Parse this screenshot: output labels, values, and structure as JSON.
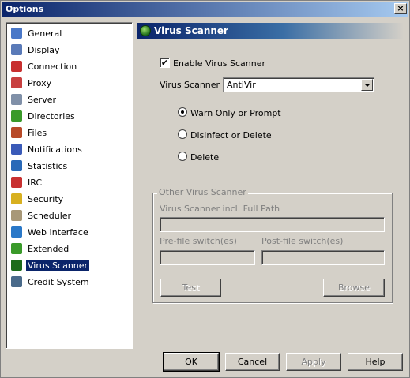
{
  "window": {
    "title": "Options",
    "close_glyph": "×"
  },
  "nav": {
    "items": [
      {
        "label": "General",
        "icon": "wrench-icon",
        "color": "#4a78c8"
      },
      {
        "label": "Display",
        "icon": "monitor-icon",
        "color": "#5a7ab8"
      },
      {
        "label": "Connection",
        "icon": "plug-icon",
        "color": "#c83030"
      },
      {
        "label": "Proxy",
        "icon": "server-arrows-icon",
        "color": "#c84040"
      },
      {
        "label": "Server",
        "icon": "tower-icon",
        "color": "#8090a8"
      },
      {
        "label": "Directories",
        "icon": "folder-icon",
        "color": "#3a9a2a"
      },
      {
        "label": "Files",
        "icon": "files-icon",
        "color": "#b84a28"
      },
      {
        "label": "Notifications",
        "icon": "bell-icon",
        "color": "#3a5ab8"
      },
      {
        "label": "Statistics",
        "icon": "chart-icon",
        "color": "#2a6ab8"
      },
      {
        "label": "IRC",
        "icon": "chat-icon",
        "color": "#c83030"
      },
      {
        "label": "Security",
        "icon": "lock-icon",
        "color": "#d8b020"
      },
      {
        "label": "Scheduler",
        "icon": "calendar-icon",
        "color": "#a89878"
      },
      {
        "label": "Web Interface",
        "icon": "globe-icon",
        "color": "#2a78c8"
      },
      {
        "label": "Extended",
        "icon": "leaf-icon",
        "color": "#3a9a2a"
      },
      {
        "label": "Virus Scanner",
        "icon": "virus-scanner-icon",
        "color": "#1d6b1a",
        "selected": true
      },
      {
        "label": "Credit System",
        "icon": "credit-icon",
        "color": "#4a6a8a"
      }
    ]
  },
  "panel": {
    "title": "Virus Scanner",
    "enable_checkbox": {
      "label": "Enable Virus Scanner",
      "checked": true,
      "mark": "✔"
    },
    "scanner_select": {
      "label": "Virus Scanner",
      "value": "AntiVir"
    },
    "radios": [
      {
        "label": "Warn Only or Prompt",
        "selected": true
      },
      {
        "label": "Disinfect or Delete",
        "selected": false
      },
      {
        "label": "Delete",
        "selected": false
      }
    ],
    "other_scanner": {
      "group_title": "Other Virus Scanner",
      "path_label": "Virus Scanner incl. Full Path",
      "pre_label": "Pre-file switch(es)",
      "post_label": "Post-file switch(es)",
      "test_label": "Test",
      "browse_label": "Browse"
    }
  },
  "buttons": {
    "ok": "OK",
    "cancel": "Cancel",
    "apply": "Apply",
    "help": "Help"
  }
}
